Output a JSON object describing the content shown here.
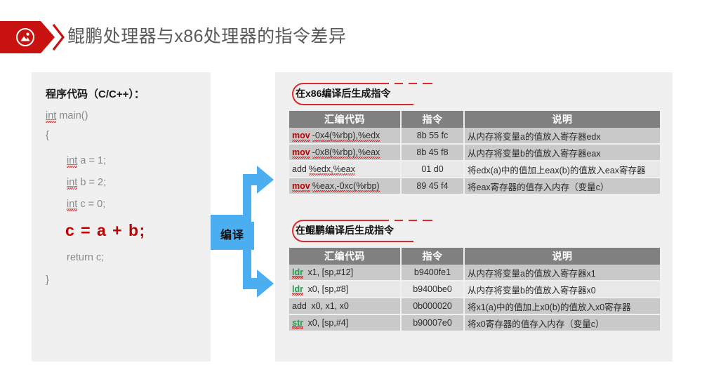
{
  "header": {
    "title": "鲲鹏处理器与x86处理器的指令差异",
    "icon": "image-picture-icon",
    "banner_color": "#c8120f",
    "title_color": "#595959"
  },
  "code_panel": {
    "title": "程序代码（C/C++）：",
    "lines": [
      {
        "indent": false,
        "keyword": "int",
        "rest": " main()"
      },
      {
        "indent": false,
        "keyword": "",
        "rest": "{"
      },
      {
        "indent": true,
        "keyword": "int",
        "rest": " a = 1;"
      },
      {
        "indent": true,
        "keyword": "int",
        "rest": " b = 2;"
      },
      {
        "indent": true,
        "keyword": "int",
        "rest": " c = 0;"
      },
      {
        "indent": true,
        "keyword": "",
        "rest": "return c;"
      },
      {
        "indent": false,
        "keyword": "",
        "rest": "}"
      }
    ],
    "highlight": "c = a + b;",
    "highlight_color": "#c00000"
  },
  "compile": {
    "label": "编译",
    "arrow_color": "#4aaef0"
  },
  "tables": [
    {
      "id": "x86",
      "title": "在x86编译后生成指令",
      "columns": [
        "汇编代码",
        "指令",
        "说明"
      ],
      "rows": [
        {
          "mnemonic": "mov",
          "mnemonic_style": "red",
          "operands": "-0x4(%rbp),%edx",
          "encoding": "8b 55 fc",
          "desc": "从内存将变量a的值放入寄存器edx"
        },
        {
          "mnemonic": "mov",
          "mnemonic_style": "red",
          "operands": " -0x8(%rbp),%eax",
          "encoding": "8b 45 f8",
          "desc": "从内存将变量b的值放入寄存器eax"
        },
        {
          "mnemonic": "add",
          "mnemonic_style": "plain",
          "operands": " %edx,%eax",
          "encoding": "01 d0",
          "desc": "将edx(a)中的值加上eax(b)的值放入eax寄存器"
        },
        {
          "mnemonic": "mov",
          "mnemonic_style": "red",
          "operands": "%eax,-0xc(%rbp)",
          "encoding": "89 45 f4",
          "desc": "将eax寄存器的值存入内存（变量c）"
        }
      ]
    },
    {
      "id": "kunpeng",
      "title": "在鲲鹏编译后生成指令",
      "columns": [
        "汇编代码",
        "指令",
        "说明"
      ],
      "rows": [
        {
          "mnemonic": "ldr",
          "mnemonic_style": "green",
          "operands": "  x1, [sp,#12]",
          "encoding": "b9400fe1",
          "desc": "从内存将变量a的值放入寄存器x1"
        },
        {
          "mnemonic": "ldr",
          "mnemonic_style": "green",
          "operands": "  x0, [sp,#8]",
          "encoding": "b9400be0",
          "desc": "从内存将变量b的值放入寄存器x0"
        },
        {
          "mnemonic": "add",
          "mnemonic_style": "plain",
          "operands": "  x0, x1, x0",
          "encoding": "0b000020",
          "desc": "将x1(a)中的值加上x0(b)的值放入x0寄存器"
        },
        {
          "mnemonic": "str",
          "mnemonic_style": "green",
          "operands": "  x0, [sp,#4]",
          "encoding": "b90007e0",
          "desc": "将x0寄存器的值存入内存（变量c）"
        }
      ]
    }
  ],
  "colors": {
    "panel_bg": "#f0f0f0",
    "table_header_bg": "#808080",
    "row_shade": "#c9c9c9",
    "row_plain": "#e8e8e8",
    "accent_red": "#c00000",
    "accent_green": "#1f9e4a",
    "ring_red": "#d92b2b"
  }
}
